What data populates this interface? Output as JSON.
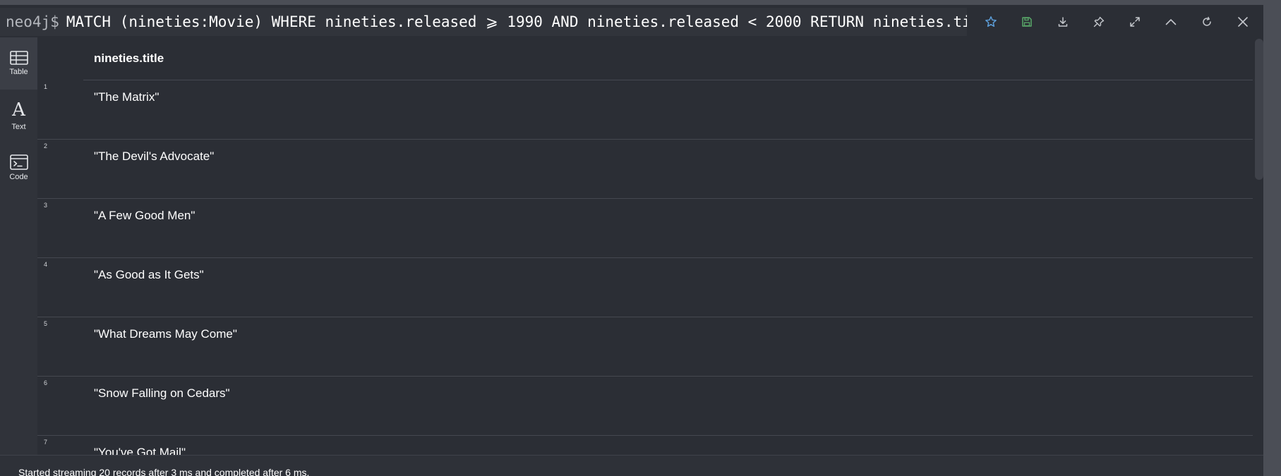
{
  "header": {
    "prompt": "neo4j$",
    "query": "MATCH (nineties:Movie) WHERE nineties.released ⩾ 1990 AND nineties.released < 2000 RETURN nineties.title"
  },
  "toolbar": {
    "icons": [
      "star-icon",
      "save-icon",
      "download-icon",
      "pin-icon",
      "expand-icon",
      "collapse-icon",
      "rerun-icon",
      "close-icon"
    ],
    "colors": {
      "star": "#5b9bd5",
      "save": "#59a869",
      "default": "#c3c6cb"
    }
  },
  "sidebar": {
    "items": [
      {
        "label": "Table",
        "icon": "table-icon",
        "active": true
      },
      {
        "label": "Text",
        "icon": "text-icon",
        "active": false
      },
      {
        "label": "Code",
        "icon": "code-icon",
        "active": false
      }
    ]
  },
  "table": {
    "column": "nineties.title",
    "rows": [
      {
        "num": "1",
        "value": "\"The Matrix\""
      },
      {
        "num": "2",
        "value": "\"The Devil's Advocate\""
      },
      {
        "num": "3",
        "value": "\"A Few Good Men\""
      },
      {
        "num": "4",
        "value": "\"As Good as It Gets\""
      },
      {
        "num": "5",
        "value": "\"What Dreams May Come\""
      },
      {
        "num": "6",
        "value": "\"Snow Falling on Cedars\""
      },
      {
        "num": "7",
        "value": "\"You've Got Mail\""
      }
    ]
  },
  "status": {
    "text": "Started streaming 20 records after 3 ms and completed after 6 ms."
  }
}
